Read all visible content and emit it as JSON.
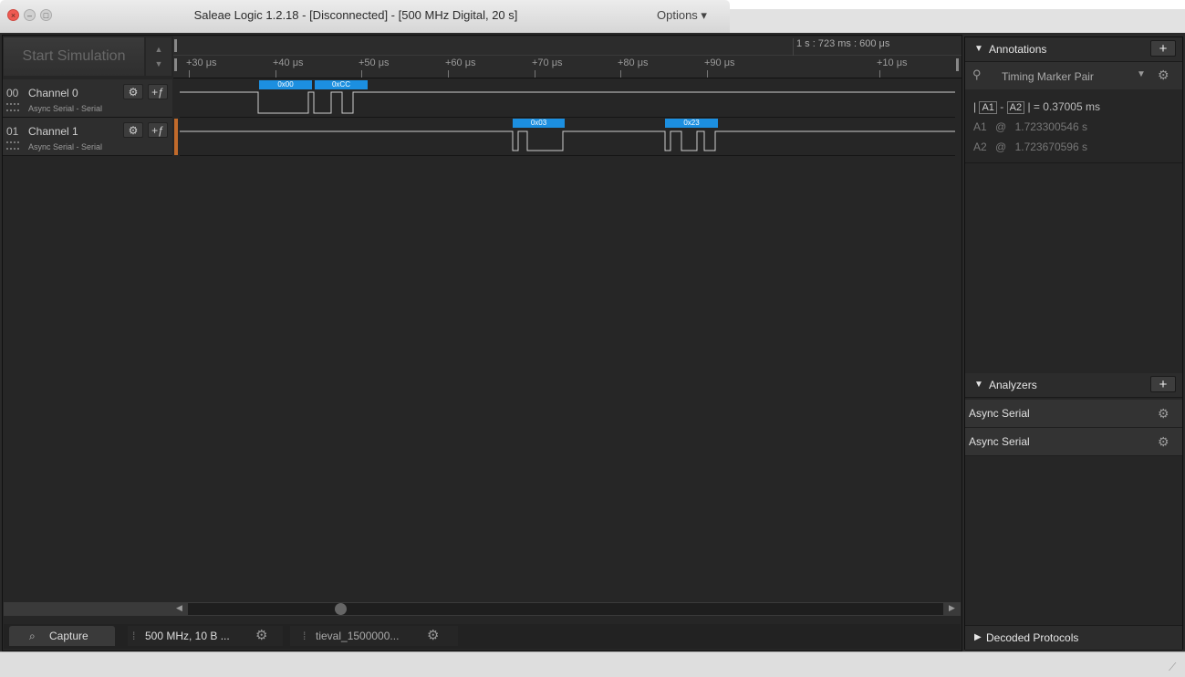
{
  "window": {
    "title": "Saleae Logic 1.2.18 - [Disconnected] - [500 MHz Digital, 20 s]",
    "options_label": "Options ▾"
  },
  "toolbar": {
    "start_simulation": "Start Simulation",
    "time_readout": "1 s : 723 ms : 600 μs"
  },
  "ruler": {
    "ticks": [
      "+30 μs",
      "+40 μs",
      "+50 μs",
      "+60 μs",
      "+70 μs",
      "+80 μs",
      "+90 μs",
      "+10 μs"
    ]
  },
  "channels": [
    {
      "num": "00",
      "name": "Channel 0",
      "analyzer": "Async Serial - Serial",
      "bytes": [
        "0x00",
        "0xCC"
      ]
    },
    {
      "num": "01",
      "name": "Channel 1",
      "analyzer": "Async Serial - Serial",
      "bytes": [
        "0x03",
        "0x23"
      ]
    }
  ],
  "bottom_tabs": {
    "capture": "Capture",
    "session1": "500 MHz, 10 B ...",
    "session2": "tieval_1500000..."
  },
  "annotations": {
    "header": "Annotations",
    "marker_pair": "Timing Marker Pair",
    "diff_prefix": "|",
    "a1": "A1",
    "dash": "-",
    "a2": "A2",
    "diff_suffix": "|",
    "equals": "=",
    "diff_value": "0.37005 ms",
    "a1_label": "A1",
    "a1_at": "@",
    "a1_time": "1.723300546 s",
    "a2_label": "A2",
    "a2_at": "@",
    "a2_time": "1.723670596 s"
  },
  "analyzers": {
    "header": "Analyzers",
    "items": [
      "Async Serial",
      "Async Serial"
    ]
  },
  "decoded_protocols": "Decoded Protocols",
  "icons": {
    "gear": "gear-icon",
    "plus": "plus-icon",
    "capture": "capture-search-icon"
  },
  "colors": {
    "byte_label": "#1c8fe0",
    "close_button": "#ee5a52",
    "trigger_marker": "#c16a2b"
  }
}
